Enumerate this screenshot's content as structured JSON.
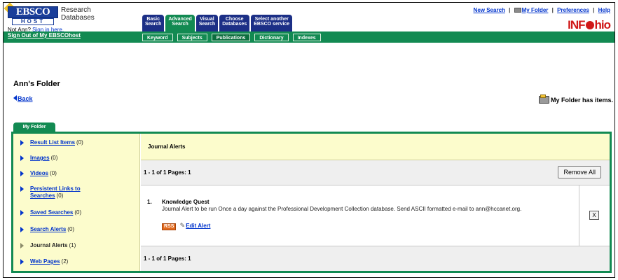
{
  "header": {
    "logo_text": "EBSCO",
    "logo_sub": "HOST",
    "product_line1": "Research",
    "product_line2": "Databases",
    "not_user_prefix": "Not Ann?",
    "not_user_link": "Sign in here.",
    "signout": "Sign Out of My EBSCOhost",
    "toplinks": {
      "new_search": "New Search",
      "my_folder": "My Folder",
      "preferences": "Preferences",
      "help": "Help",
      "separator": "|"
    },
    "partner_logo": {
      "part1": "INF",
      "part2": "hio"
    }
  },
  "tabs": [
    {
      "line1": "Basic",
      "line2": "Search",
      "active": false
    },
    {
      "line1": "Advanced",
      "line2": "Search",
      "active": true
    },
    {
      "line1": "Visual",
      "line2": "Search",
      "active": false
    },
    {
      "line1": "Choose",
      "line2": "Databases",
      "active": false
    },
    {
      "line1": "Select another",
      "line2": "EBSCO service",
      "active": false
    }
  ],
  "subtabs": [
    {
      "label": "Keyword",
      "active": false
    },
    {
      "label": "Subjects",
      "active": false
    },
    {
      "label": "Publications",
      "active": true
    },
    {
      "label": "Dictionary",
      "active": false
    },
    {
      "label": "Indexes",
      "active": false
    }
  ],
  "page": {
    "title": "Ann's Folder",
    "back": "Back",
    "folder_status": "My Folder has items."
  },
  "folder_tab": "My Folder",
  "sidebar": {
    "items": [
      {
        "label": "Result List Items",
        "count": "(0)"
      },
      {
        "label": "Images",
        "count": "(0)"
      },
      {
        "label": "Videos",
        "count": "(0)"
      },
      {
        "label": "Persistent Links to Searches",
        "count": "(0)"
      },
      {
        "label": "Saved Searches",
        "count": "(0)"
      },
      {
        "label": "Search Alerts",
        "count": "(0)"
      },
      {
        "label": "Journal Alerts",
        "count": "(1)"
      },
      {
        "label": "Web Pages",
        "count": "(2)"
      }
    ]
  },
  "main": {
    "section_title": "Journal Alerts",
    "pager_top": "1 - 1 of 1  Pages: 1",
    "remove_all": "Remove All",
    "pager_bottom": "1 - 1 of 1  Pages: 1",
    "items": [
      {
        "number": "1.",
        "title": "Knowledge Quest",
        "description": "Journal Alert to be run Once a day against the Professional Development Collection database. Send ASCII formatted e-mail to ann@hccanet.org.",
        "rss_label": "RSS",
        "edit_label": "Edit Alert",
        "delete_label": "X"
      }
    ]
  }
}
